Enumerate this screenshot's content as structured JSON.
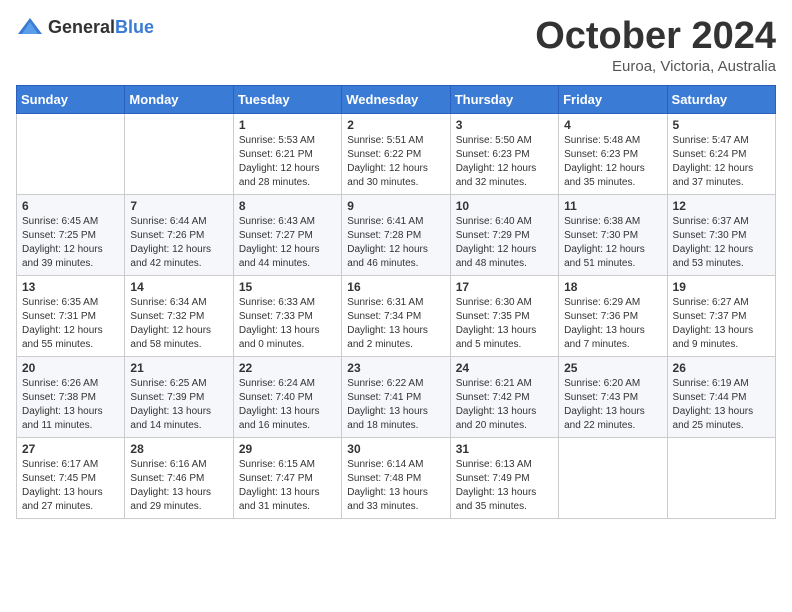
{
  "header": {
    "logo_general": "General",
    "logo_blue": "Blue",
    "title": "October 2024",
    "location": "Euroa, Victoria, Australia"
  },
  "days_of_week": [
    "Sunday",
    "Monday",
    "Tuesday",
    "Wednesday",
    "Thursday",
    "Friday",
    "Saturday"
  ],
  "weeks": [
    [
      {
        "day": null,
        "sunrise": null,
        "sunset": null,
        "daylight": null
      },
      {
        "day": null,
        "sunrise": null,
        "sunset": null,
        "daylight": null
      },
      {
        "day": "1",
        "sunrise": "Sunrise: 5:53 AM",
        "sunset": "Sunset: 6:21 PM",
        "daylight": "Daylight: 12 hours and 28 minutes."
      },
      {
        "day": "2",
        "sunrise": "Sunrise: 5:51 AM",
        "sunset": "Sunset: 6:22 PM",
        "daylight": "Daylight: 12 hours and 30 minutes."
      },
      {
        "day": "3",
        "sunrise": "Sunrise: 5:50 AM",
        "sunset": "Sunset: 6:23 PM",
        "daylight": "Daylight: 12 hours and 32 minutes."
      },
      {
        "day": "4",
        "sunrise": "Sunrise: 5:48 AM",
        "sunset": "Sunset: 6:23 PM",
        "daylight": "Daylight: 12 hours and 35 minutes."
      },
      {
        "day": "5",
        "sunrise": "Sunrise: 5:47 AM",
        "sunset": "Sunset: 6:24 PM",
        "daylight": "Daylight: 12 hours and 37 minutes."
      }
    ],
    [
      {
        "day": "6",
        "sunrise": "Sunrise: 6:45 AM",
        "sunset": "Sunset: 7:25 PM",
        "daylight": "Daylight: 12 hours and 39 minutes."
      },
      {
        "day": "7",
        "sunrise": "Sunrise: 6:44 AM",
        "sunset": "Sunset: 7:26 PM",
        "daylight": "Daylight: 12 hours and 42 minutes."
      },
      {
        "day": "8",
        "sunrise": "Sunrise: 6:43 AM",
        "sunset": "Sunset: 7:27 PM",
        "daylight": "Daylight: 12 hours and 44 minutes."
      },
      {
        "day": "9",
        "sunrise": "Sunrise: 6:41 AM",
        "sunset": "Sunset: 7:28 PM",
        "daylight": "Daylight: 12 hours and 46 minutes."
      },
      {
        "day": "10",
        "sunrise": "Sunrise: 6:40 AM",
        "sunset": "Sunset: 7:29 PM",
        "daylight": "Daylight: 12 hours and 48 minutes."
      },
      {
        "day": "11",
        "sunrise": "Sunrise: 6:38 AM",
        "sunset": "Sunset: 7:30 PM",
        "daylight": "Daylight: 12 hours and 51 minutes."
      },
      {
        "day": "12",
        "sunrise": "Sunrise: 6:37 AM",
        "sunset": "Sunset: 7:30 PM",
        "daylight": "Daylight: 12 hours and 53 minutes."
      }
    ],
    [
      {
        "day": "13",
        "sunrise": "Sunrise: 6:35 AM",
        "sunset": "Sunset: 7:31 PM",
        "daylight": "Daylight: 12 hours and 55 minutes."
      },
      {
        "day": "14",
        "sunrise": "Sunrise: 6:34 AM",
        "sunset": "Sunset: 7:32 PM",
        "daylight": "Daylight: 12 hours and 58 minutes."
      },
      {
        "day": "15",
        "sunrise": "Sunrise: 6:33 AM",
        "sunset": "Sunset: 7:33 PM",
        "daylight": "Daylight: 13 hours and 0 minutes."
      },
      {
        "day": "16",
        "sunrise": "Sunrise: 6:31 AM",
        "sunset": "Sunset: 7:34 PM",
        "daylight": "Daylight: 13 hours and 2 minutes."
      },
      {
        "day": "17",
        "sunrise": "Sunrise: 6:30 AM",
        "sunset": "Sunset: 7:35 PM",
        "daylight": "Daylight: 13 hours and 5 minutes."
      },
      {
        "day": "18",
        "sunrise": "Sunrise: 6:29 AM",
        "sunset": "Sunset: 7:36 PM",
        "daylight": "Daylight: 13 hours and 7 minutes."
      },
      {
        "day": "19",
        "sunrise": "Sunrise: 6:27 AM",
        "sunset": "Sunset: 7:37 PM",
        "daylight": "Daylight: 13 hours and 9 minutes."
      }
    ],
    [
      {
        "day": "20",
        "sunrise": "Sunrise: 6:26 AM",
        "sunset": "Sunset: 7:38 PM",
        "daylight": "Daylight: 13 hours and 11 minutes."
      },
      {
        "day": "21",
        "sunrise": "Sunrise: 6:25 AM",
        "sunset": "Sunset: 7:39 PM",
        "daylight": "Daylight: 13 hours and 14 minutes."
      },
      {
        "day": "22",
        "sunrise": "Sunrise: 6:24 AM",
        "sunset": "Sunset: 7:40 PM",
        "daylight": "Daylight: 13 hours and 16 minutes."
      },
      {
        "day": "23",
        "sunrise": "Sunrise: 6:22 AM",
        "sunset": "Sunset: 7:41 PM",
        "daylight": "Daylight: 13 hours and 18 minutes."
      },
      {
        "day": "24",
        "sunrise": "Sunrise: 6:21 AM",
        "sunset": "Sunset: 7:42 PM",
        "daylight": "Daylight: 13 hours and 20 minutes."
      },
      {
        "day": "25",
        "sunrise": "Sunrise: 6:20 AM",
        "sunset": "Sunset: 7:43 PM",
        "daylight": "Daylight: 13 hours and 22 minutes."
      },
      {
        "day": "26",
        "sunrise": "Sunrise: 6:19 AM",
        "sunset": "Sunset: 7:44 PM",
        "daylight": "Daylight: 13 hours and 25 minutes."
      }
    ],
    [
      {
        "day": "27",
        "sunrise": "Sunrise: 6:17 AM",
        "sunset": "Sunset: 7:45 PM",
        "daylight": "Daylight: 13 hours and 27 minutes."
      },
      {
        "day": "28",
        "sunrise": "Sunrise: 6:16 AM",
        "sunset": "Sunset: 7:46 PM",
        "daylight": "Daylight: 13 hours and 29 minutes."
      },
      {
        "day": "29",
        "sunrise": "Sunrise: 6:15 AM",
        "sunset": "Sunset: 7:47 PM",
        "daylight": "Daylight: 13 hours and 31 minutes."
      },
      {
        "day": "30",
        "sunrise": "Sunrise: 6:14 AM",
        "sunset": "Sunset: 7:48 PM",
        "daylight": "Daylight: 13 hours and 33 minutes."
      },
      {
        "day": "31",
        "sunrise": "Sunrise: 6:13 AM",
        "sunset": "Sunset: 7:49 PM",
        "daylight": "Daylight: 13 hours and 35 minutes."
      },
      {
        "day": null,
        "sunrise": null,
        "sunset": null,
        "daylight": null
      },
      {
        "day": null,
        "sunrise": null,
        "sunset": null,
        "daylight": null
      }
    ]
  ]
}
